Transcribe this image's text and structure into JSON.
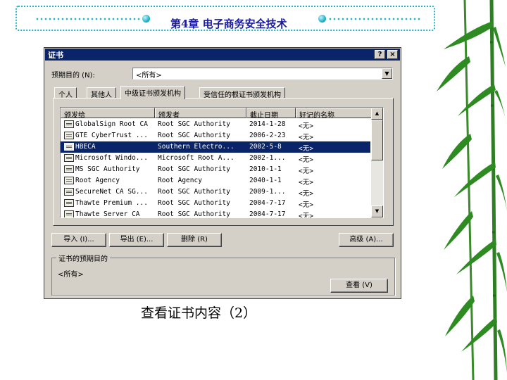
{
  "slide": {
    "title": "第4章  电子商务安全技术",
    "caption": "查看证书内容（2）"
  },
  "dialog": {
    "title": "证书",
    "help_button": "?",
    "close_button": "×",
    "purpose_label": "预期目的 (N):",
    "purpose_value": "<所有>",
    "tabs": [
      "个人",
      "其他人",
      "中级证书颁发机构",
      "受信任的根证书颁发机构"
    ],
    "active_tab": "中级证书颁发机构",
    "columns": [
      "颁发给",
      "颁发者",
      "截止日期",
      "好记的名称"
    ],
    "rows": [
      {
        "issued_to": "GlobalSign Root CA",
        "issued_by": "Root SGC Authority",
        "expires": "2014-1-28",
        "friendly": "<无>"
      },
      {
        "issued_to": "GTE CyberTrust ...",
        "issued_by": "Root SGC Authority",
        "expires": "2006-2-23",
        "friendly": "<无>"
      },
      {
        "issued_to": "HBECA",
        "issued_by": "Southern Electro...",
        "expires": "2002-5-8",
        "friendly": "<无>",
        "selected": true
      },
      {
        "issued_to": "Microsoft Windo...",
        "issued_by": "Microsoft Root A...",
        "expires": "2002-1...",
        "friendly": "<无>"
      },
      {
        "issued_to": "MS SGC Authority",
        "issued_by": "Root SGC Authority",
        "expires": "2010-1-1",
        "friendly": "<无>"
      },
      {
        "issued_to": "Root Agency",
        "issued_by": "Root Agency",
        "expires": "2040-1-1",
        "friendly": "<无>"
      },
      {
        "issued_to": "SecureNet CA SG...",
        "issued_by": "Root SGC Authority",
        "expires": "2009-1...",
        "friendly": "<无>"
      },
      {
        "issued_to": "Thawte Premium ...",
        "issued_by": "Root SGC Authority",
        "expires": "2004-7-17",
        "friendly": "<无>"
      },
      {
        "issued_to": "Thawte Server CA",
        "issued_by": "Root SGC Authority",
        "expires": "2004-7-17",
        "friendly": "<无>"
      }
    ],
    "import_button": "导入 (I)...",
    "export_button": "导出 (E)...",
    "remove_button": "删除 (R)",
    "advanced_button": "高级 (A)...",
    "group_label": "证书的预期目的",
    "group_value": "<所有>",
    "view_button": "查看 (V)"
  },
  "colors": {
    "selection": "#0a246a",
    "dialog_face": "#d4d0c8",
    "accent_border": "#1fb4c8",
    "title_text": "#1a1aa0"
  }
}
